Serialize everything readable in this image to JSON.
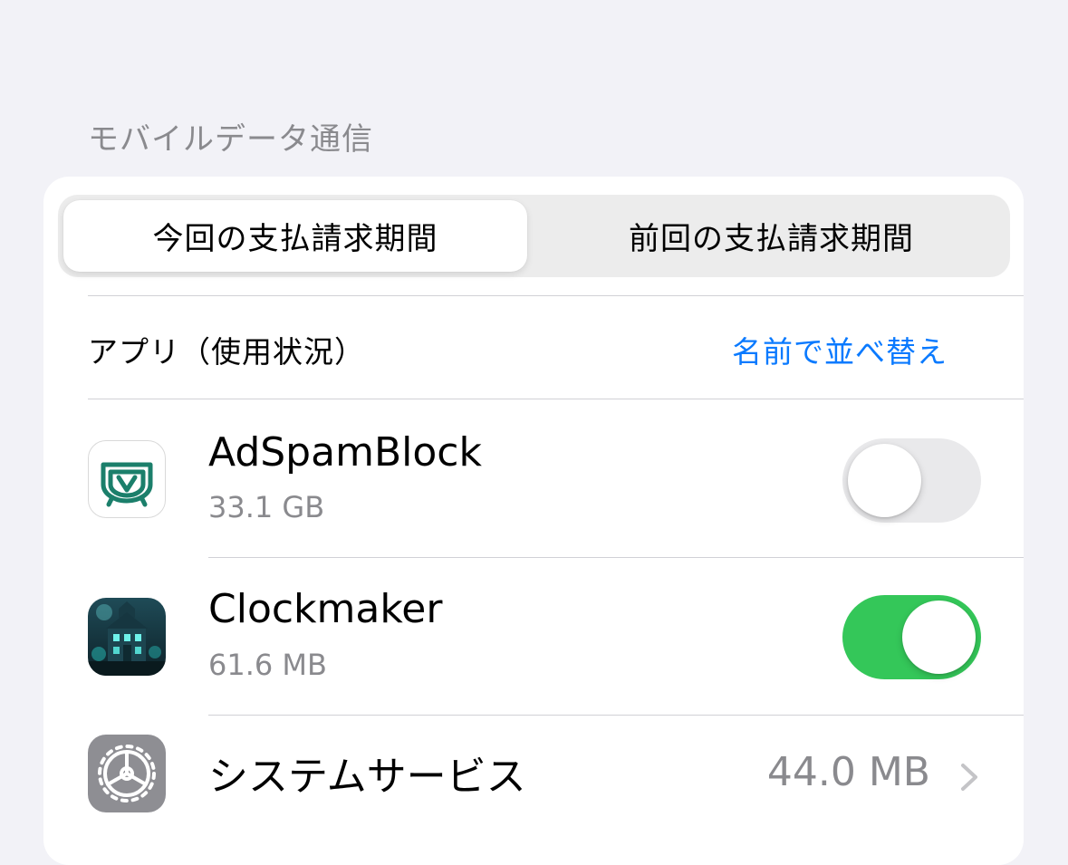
{
  "section": {
    "title": "モバイルデータ通信"
  },
  "segmented": {
    "current_label": "今回の支払請求期間",
    "previous_label": "前回の支払請求期間",
    "selected": "current"
  },
  "apps_header": {
    "label": "アプリ（使用状況）",
    "sort_label": "名前で並べ替え"
  },
  "apps": [
    {
      "name": "AdSpamBlock",
      "usage": "33.1 GB",
      "enabled": false,
      "icon": "adspamblock-icon"
    },
    {
      "name": "Clockmaker",
      "usage": "61.6 MB",
      "enabled": true,
      "icon": "clockmaker-icon"
    }
  ],
  "system_services": {
    "name": "システムサービス",
    "value": "44.0 MB",
    "icon": "gear-icon"
  },
  "colors": {
    "accent": "#0a7aff",
    "toggle_on": "#34c759",
    "toggle_off": "#e9e9eb",
    "icon_green": "#1b7f6b"
  }
}
